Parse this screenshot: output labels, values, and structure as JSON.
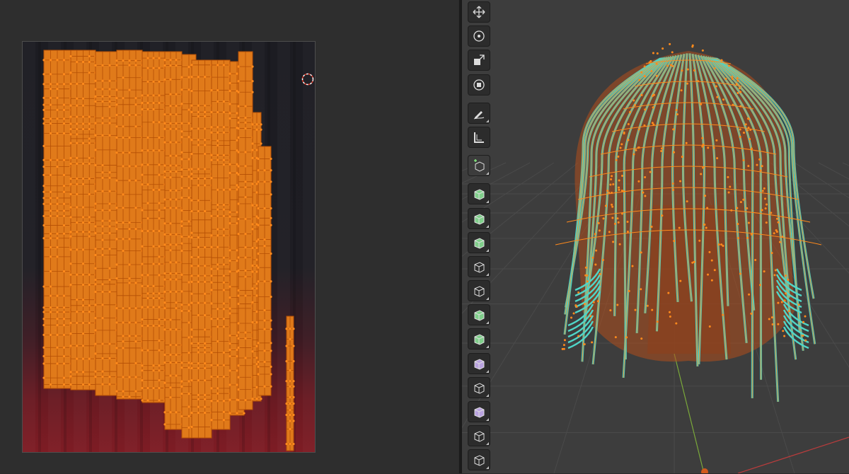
{
  "colors": {
    "uv_island_fill": "#e07a1a",
    "uv_edge": "#b44f05",
    "uv_vertex": "#ff8a1c",
    "mesh_edge_selected": "#4fd6c8",
    "mesh_face_tint": "#b34e1c",
    "viewport_bg": "#3d3d3d",
    "editor_bg": "#2e2e2e",
    "y_axis": "#7aa83a",
    "x_axis": "#b83c3c"
  },
  "toolbar": {
    "tools": [
      {
        "name": "move-icon",
        "group": 1
      },
      {
        "name": "rotate-icon",
        "group": 1
      },
      {
        "name": "scale-icon",
        "group": 1
      },
      {
        "name": "transform-icon",
        "group": 1
      },
      {
        "name": "annotate-icon",
        "group": 2
      },
      {
        "name": "measure-icon",
        "group": 2
      },
      {
        "name": "add-cube-icon",
        "group": 3
      },
      {
        "name": "extrude-region-icon",
        "group": 4
      },
      {
        "name": "inset-faces-icon",
        "group": 4
      },
      {
        "name": "bevel-icon",
        "group": 4
      },
      {
        "name": "loop-cut-icon",
        "group": 4
      },
      {
        "name": "knife-icon",
        "group": 4
      },
      {
        "name": "poly-build-icon",
        "group": 4
      },
      {
        "name": "spin-icon",
        "group": 4
      },
      {
        "name": "smooth-vertices-icon",
        "group": 4
      },
      {
        "name": "edge-slide-icon",
        "group": 4
      },
      {
        "name": "shrink-fatten-icon",
        "group": 4
      },
      {
        "name": "shear-icon",
        "group": 4
      },
      {
        "name": "rip-region-icon",
        "group": 4
      }
    ]
  }
}
